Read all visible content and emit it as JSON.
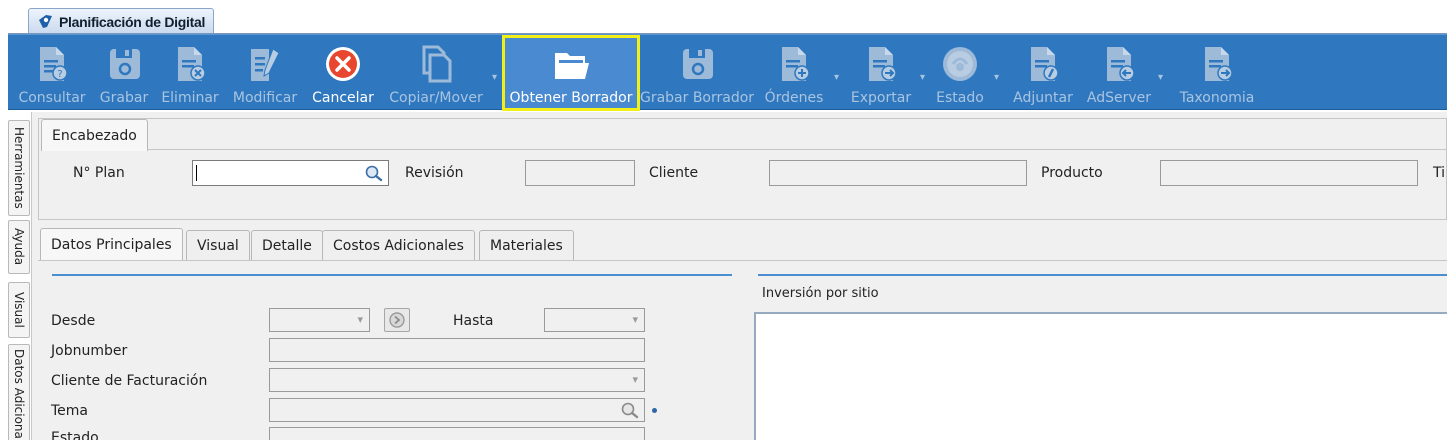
{
  "window": {
    "tab_title": "Planificación de Digital"
  },
  "toolbar": {
    "buttons": [
      {
        "label": "Consultar",
        "icon": "doc-question-icon",
        "enabled": false
      },
      {
        "label": "Grabar",
        "icon": "floppy-icon",
        "enabled": false
      },
      {
        "label": "Eliminar",
        "icon": "doc-delete-icon",
        "enabled": false
      },
      {
        "label": "Modificar",
        "icon": "doc-edit-icon",
        "enabled": false
      },
      {
        "label": "Cancelar",
        "icon": "cancel-icon",
        "enabled": true
      },
      {
        "label": "Copiar/Mover",
        "icon": "copy-icon",
        "enabled": false
      },
      {
        "label": "Obtener Borrador",
        "icon": "folder-open-icon",
        "enabled": true,
        "highlighted": true
      },
      {
        "label": "Grabar Borrador",
        "icon": "floppy-icon",
        "enabled": false
      },
      {
        "label": "Órdenes",
        "icon": "doc-add-icon",
        "enabled": false
      },
      {
        "label": "Exportar",
        "icon": "doc-export-icon",
        "enabled": false
      },
      {
        "label": "Estado",
        "icon": "status-icon",
        "enabled": false
      },
      {
        "label": "Adjuntar",
        "icon": "doc-attach-icon",
        "enabled": false
      },
      {
        "label": "AdServer",
        "icon": "doc-back-icon",
        "enabled": false
      },
      {
        "label": "Taxonomia",
        "icon": "doc-forward-icon",
        "enabled": false
      }
    ]
  },
  "side_tabs": [
    "Herramientas",
    "Ayuda",
    "Visual",
    "Datos Adicionales"
  ],
  "header": {
    "tab": "Encabezado",
    "plan_label": "N° Plan",
    "plan_value": "",
    "revision_label": "Revisión",
    "cliente_label": "Cliente",
    "producto_label": "Producto",
    "cutoff_label": "Ti"
  },
  "detail_tabs": [
    "Datos Principales",
    "Visual",
    "Detalle",
    "Costos Adicionales",
    "Materiales"
  ],
  "form": {
    "desde_label": "Desde",
    "hasta_label": "Hasta",
    "jobnumber_label": "Jobnumber",
    "cliente_facturacion_label": "Cliente de Facturación",
    "tema_label": "Tema",
    "estado_label": "Estado"
  },
  "inversion": {
    "title": "Inversión por sitio"
  },
  "colors": {
    "ribbon": "#2f78bf",
    "highlight_outline": "#f2ee17",
    "accent_line": "#4b8fd0"
  }
}
